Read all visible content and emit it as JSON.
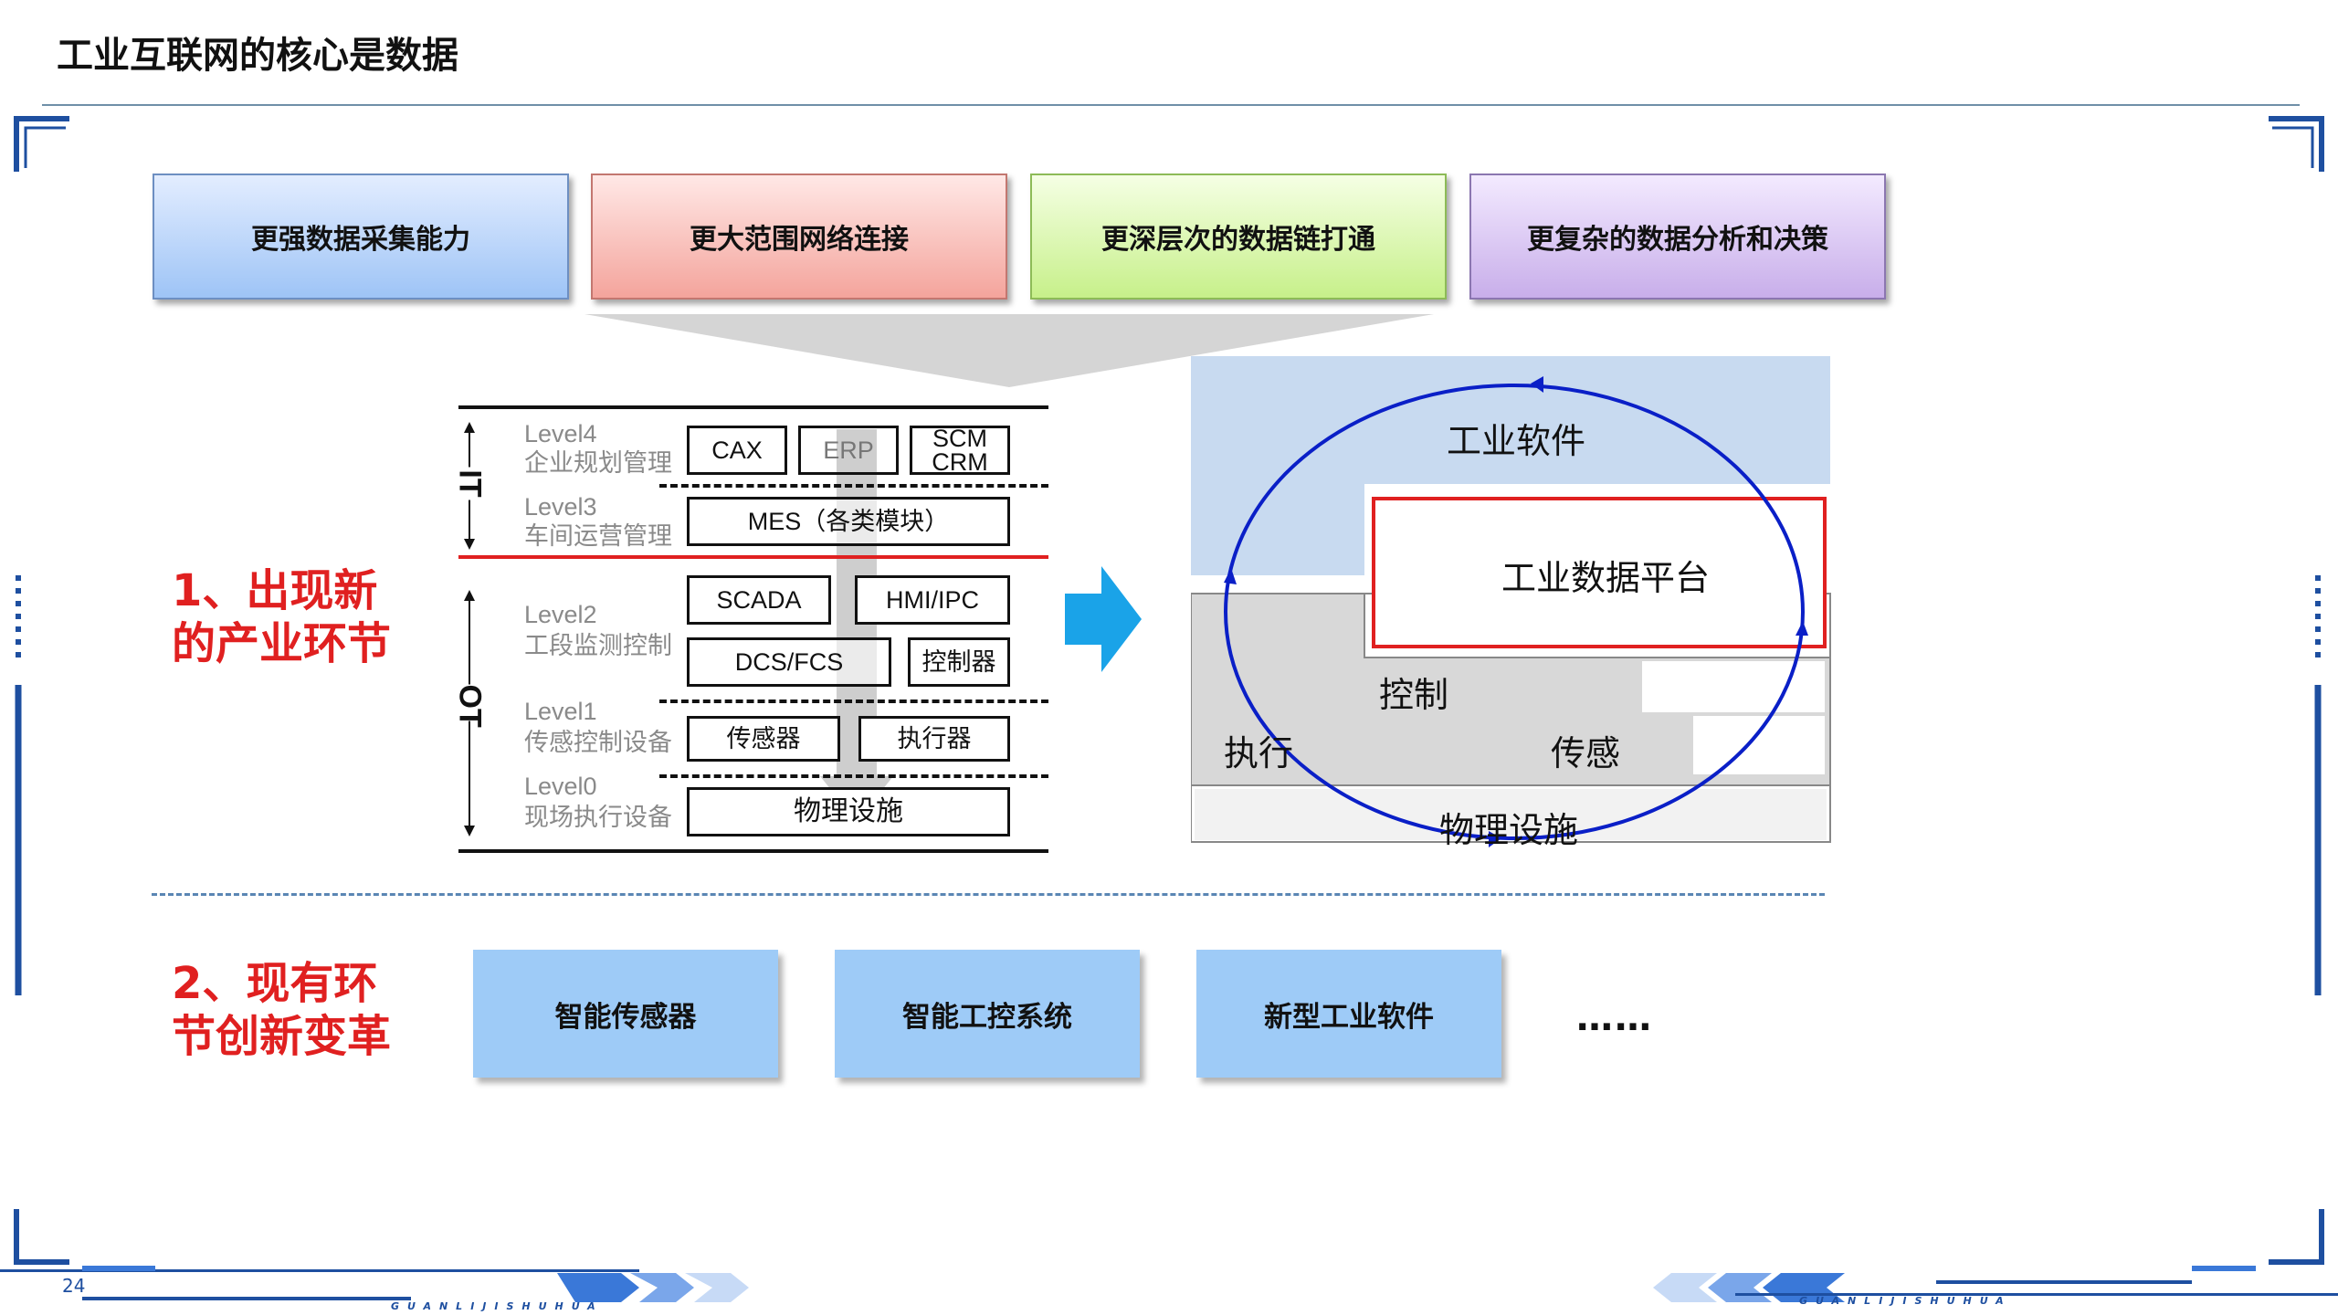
{
  "title": "工业互联网的核心是数据",
  "capabilities": [
    {
      "label": "更强数据采集能力",
      "color": "#9ec4f6"
    },
    {
      "label": "更大范围网络连接",
      "color": "#f4a49c"
    },
    {
      "label": "更深层次的数据链打通",
      "color": "#c7f08a"
    },
    {
      "label": "更复杂的数据分析和决策",
      "color": "#c8aeea"
    }
  ],
  "section1_heading": [
    "1、出现新",
    "的产业环节"
  ],
  "section2_heading": [
    "2、现有环",
    "节创新变革"
  ],
  "levels": {
    "it_label": "IT",
    "ot_label": "OT",
    "level4": {
      "name": "Level4",
      "desc": "企业规划管理",
      "boxes": [
        "CAX",
        "ERP"
      ],
      "box3": [
        "SCM",
        "CRM"
      ]
    },
    "level3": {
      "name": "Level3",
      "desc": "车间运营管理",
      "boxes": [
        "MES（各类模块）"
      ]
    },
    "level2": {
      "name": "Level2",
      "desc": "工段监测控制",
      "boxes": [
        "SCADA",
        "HMI/IPC",
        "DCS/FCS",
        "控制器"
      ]
    },
    "level1": {
      "name": "Level1",
      "desc": "传感控制设备",
      "boxes": [
        "传感器",
        "执行器"
      ]
    },
    "level0": {
      "name": "Level0",
      "desc": "现场执行设备",
      "boxes": [
        "物理设施"
      ]
    }
  },
  "platform": {
    "software": "工业软件",
    "data_platform": "工业数据平台",
    "control": "控制",
    "execute": "执行",
    "sense": "传感",
    "physical": "物理设施"
  },
  "innovations": [
    "智能传感器",
    "智能工控系统",
    "新型工业软件",
    "……"
  ],
  "page_number": "24",
  "footer_brand": "GUANLIJISHUHUA",
  "colors": {
    "accent_red": "#e02020",
    "accent_blue": "#1e4fa0",
    "arrow_cyan": "#1aa3e8",
    "cycle_blue": "#0a1fc7"
  }
}
